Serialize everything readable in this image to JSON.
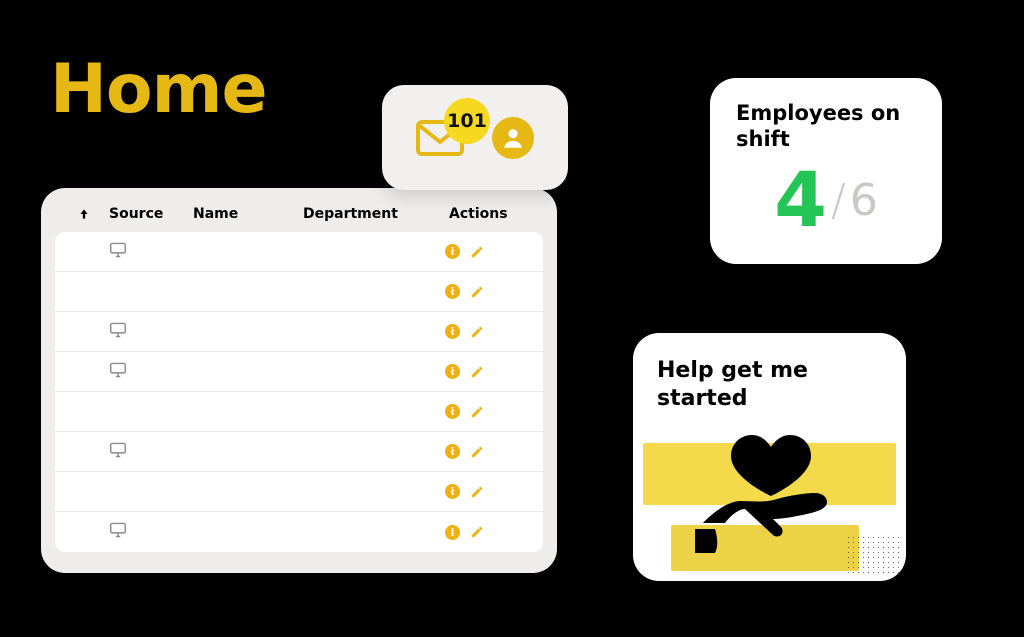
{
  "colors": {
    "accent_yellow": "#e6b814",
    "status_green": "#24c455",
    "status_pink": "#e83571"
  },
  "page": {
    "title": "Home"
  },
  "notifications": {
    "unread_count": "101"
  },
  "table": {
    "headers": {
      "sort": "↑",
      "source": "Source",
      "name": "Name",
      "department": "Department",
      "actions": "Actions"
    },
    "rows": [
      {
        "status": "green",
        "has_source_icon": true
      },
      {
        "status": "pink",
        "has_source_icon": false
      },
      {
        "status": "green",
        "has_source_icon": true
      },
      {
        "status": "green",
        "has_source_icon": true
      },
      {
        "status": "pink",
        "has_source_icon": false
      },
      {
        "status": "green",
        "has_source_icon": true
      },
      {
        "status": "pink",
        "has_source_icon": false
      },
      {
        "status": "green",
        "has_source_icon": true
      }
    ]
  },
  "employees_card": {
    "title": "Employees on shift",
    "on_shift": "4",
    "separator": "/",
    "total": "6"
  },
  "help_card": {
    "title": "Help get me started"
  }
}
